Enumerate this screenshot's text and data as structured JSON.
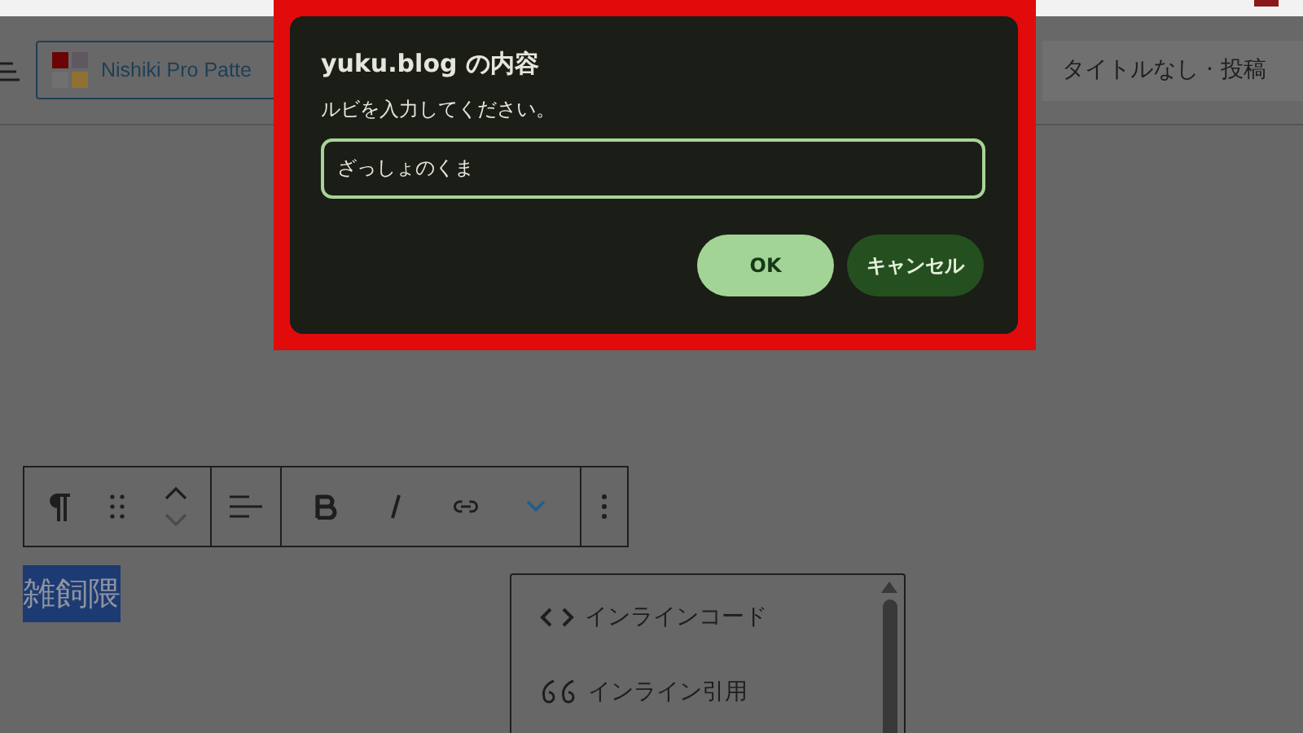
{
  "editor_header": {
    "pattern_button": "Nishiki Pro Patte",
    "document_title": "タイトルなし · 投稿"
  },
  "selected_text": "雑飼隈",
  "format_menu": {
    "items": [
      {
        "kind": "code",
        "label": "インラインコード"
      },
      {
        "kind": "quote",
        "label": "インライン引用"
      }
    ]
  },
  "dialog": {
    "title": "yuku.blog の内容",
    "message": "ルビを入力してください。",
    "input_value": "ざっしょのくま",
    "buttons": [
      {
        "kind": "primary",
        "label": "OK"
      },
      {
        "kind": "secondary",
        "label": "キャンセル"
      }
    ]
  }
}
